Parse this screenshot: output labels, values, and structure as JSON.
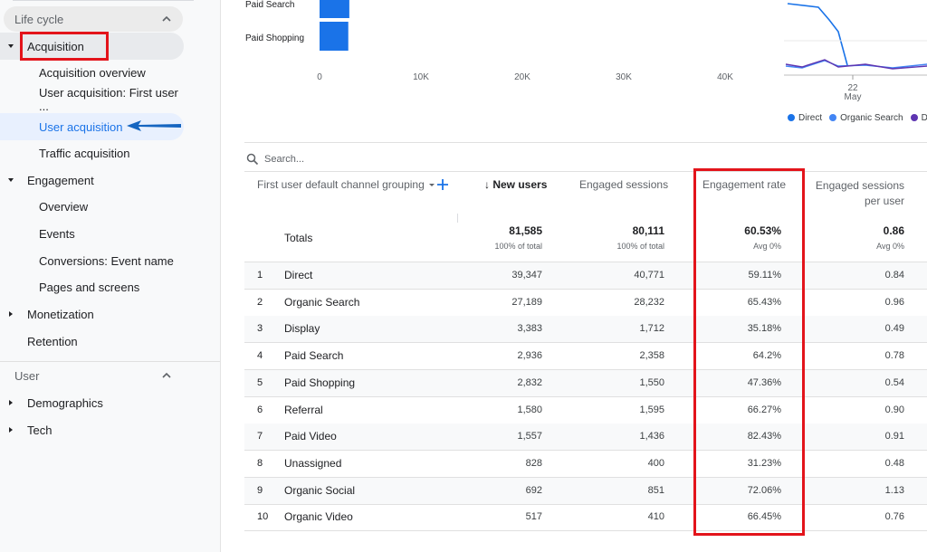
{
  "sidebar": {
    "lifecycle_label": "Life cycle",
    "items": [
      {
        "label": "Acquisition"
      },
      {
        "label": "Acquisition overview"
      },
      {
        "label": "User acquisition: First user ..."
      },
      {
        "label": "User acquisition"
      },
      {
        "label": "Traffic acquisition"
      },
      {
        "label": "Engagement"
      },
      {
        "label": "Overview"
      },
      {
        "label": "Events"
      },
      {
        "label": "Conversions: Event name"
      },
      {
        "label": "Pages and screens"
      },
      {
        "label": "Monetization"
      },
      {
        "label": "Retention"
      }
    ],
    "user_label": "User",
    "user_items": [
      {
        "label": "Demographics"
      },
      {
        "label": "Tech"
      }
    ]
  },
  "colors": {
    "accent": "#1a73e8",
    "highlight": "#e3141b",
    "arrow": "#1565c0",
    "direct": "#1a73e8",
    "organic_search": "#4285f4",
    "display": "#5e35b1"
  },
  "chart_data": [
    {
      "type": "bar",
      "orientation": "horizontal",
      "categories": [
        "Paid Search",
        "Paid Shopping"
      ],
      "values": [
        2936,
        2832
      ],
      "x_ticks": [
        "0",
        "10K",
        "20K",
        "30K",
        "40K"
      ],
      "xlim": [
        0,
        40000
      ]
    },
    {
      "type": "line",
      "x_label_day": "22",
      "x_label_month": "May",
      "series": [
        {
          "name": "Direct",
          "color": "#1a73e8"
        },
        {
          "name": "Organic Search",
          "color": "#4285f4"
        },
        {
          "name": "Di",
          "color": "#5e35b1"
        }
      ]
    }
  ],
  "table": {
    "search_placeholder": "Search...",
    "dimension_header": "First user default channel grouping",
    "columns": [
      {
        "label": "New users",
        "sort_arrow": "↓"
      },
      {
        "label": "Engaged sessions"
      },
      {
        "label": "Engagement rate"
      },
      {
        "label": "Engaged sessions",
        "label2": "per user"
      }
    ],
    "totals": {
      "label": "Totals",
      "new_users": "81,585",
      "new_users_sub": "100% of total",
      "engaged_sessions": "80,111",
      "engaged_sessions_sub": "100% of total",
      "engagement_rate": "60.53%",
      "engagement_rate_sub": "Avg 0%",
      "per_user": "0.86",
      "per_user_sub": "Avg 0%"
    },
    "rows": [
      {
        "idx": "1",
        "name": "Direct",
        "new_users": "39,347",
        "engaged_sessions": "40,771",
        "engagement_rate": "59.11%",
        "per_user": "0.84"
      },
      {
        "idx": "2",
        "name": "Organic Search",
        "new_users": "27,189",
        "engaged_sessions": "28,232",
        "engagement_rate": "65.43%",
        "per_user": "0.96"
      },
      {
        "idx": "3",
        "name": "Display",
        "new_users": "3,383",
        "engaged_sessions": "1,712",
        "engagement_rate": "35.18%",
        "per_user": "0.49"
      },
      {
        "idx": "4",
        "name": "Paid Search",
        "new_users": "2,936",
        "engaged_sessions": "2,358",
        "engagement_rate": "64.2%",
        "per_user": "0.78"
      },
      {
        "idx": "5",
        "name": "Paid Shopping",
        "new_users": "2,832",
        "engaged_sessions": "1,550",
        "engagement_rate": "47.36%",
        "per_user": "0.54"
      },
      {
        "idx": "6",
        "name": "Referral",
        "new_users": "1,580",
        "engaged_sessions": "1,595",
        "engagement_rate": "66.27%",
        "per_user": "0.90"
      },
      {
        "idx": "7",
        "name": "Paid Video",
        "new_users": "1,557",
        "engaged_sessions": "1,436",
        "engagement_rate": "82.43%",
        "per_user": "0.91"
      },
      {
        "idx": "8",
        "name": "Unassigned",
        "new_users": "828",
        "engaged_sessions": "400",
        "engagement_rate": "31.23%",
        "per_user": "0.48"
      },
      {
        "idx": "9",
        "name": "Organic Social",
        "new_users": "692",
        "engaged_sessions": "851",
        "engagement_rate": "72.06%",
        "per_user": "1.13"
      },
      {
        "idx": "10",
        "name": "Organic Video",
        "new_users": "517",
        "engaged_sessions": "410",
        "engagement_rate": "66.45%",
        "per_user": "0.76"
      }
    ]
  }
}
